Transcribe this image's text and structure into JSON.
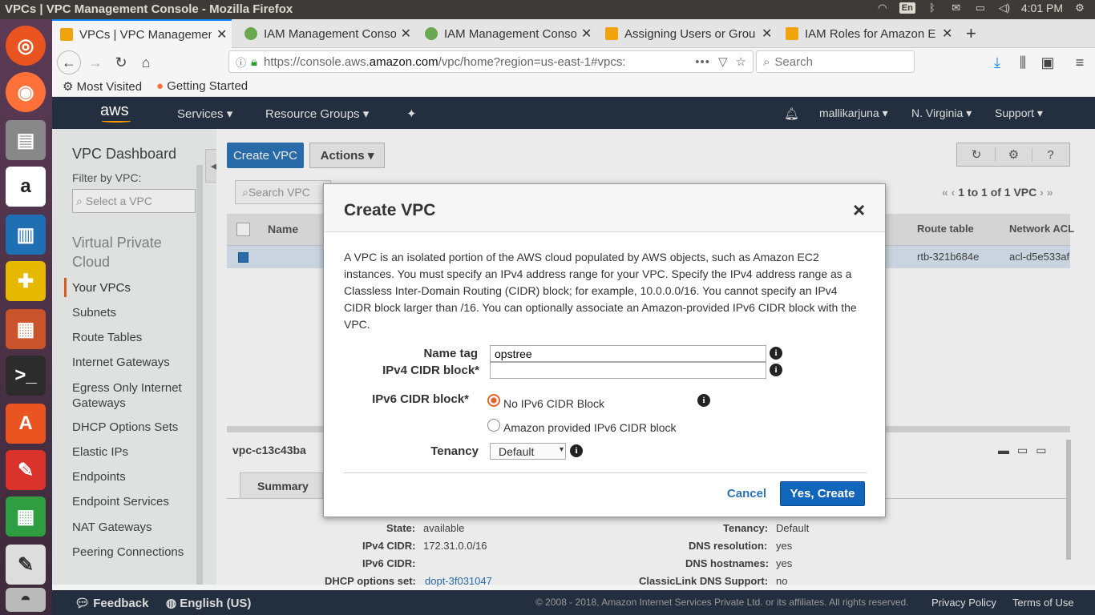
{
  "system": {
    "window_title": "VPCs | VPC Management Console - Mozilla Firefox",
    "keyboard": "En",
    "time": "4:01 PM"
  },
  "tabs": [
    {
      "label": "VPCs | VPC Managemen",
      "color": "#f0a30a"
    },
    {
      "label": "IAM Management Conso",
      "color": "#6aa84f"
    },
    {
      "label": "IAM Management Conso",
      "color": "#6aa84f"
    },
    {
      "label": "Assigning Users or Grou",
      "color": "#f0a30a"
    },
    {
      "label": "IAM Roles for Amazon E",
      "color": "#f0a30a"
    }
  ],
  "nav": {
    "url_prefix": "https://console.aws.",
    "url_domain": "amazon.com",
    "url_suffix": "/vpc/home?region=us-east-1#vpcs:",
    "url_more": "•••",
    "search_placeholder": "Search"
  },
  "bookmarks": {
    "most_visited": "Most Visited",
    "getting_started": "Getting Started"
  },
  "aws": {
    "logo": "aws",
    "services": "Services",
    "resource_groups": "Resource Groups",
    "user": "mallikarjuna",
    "region": "N. Virginia",
    "support": "Support"
  },
  "sidebar": {
    "dashboard": "VPC Dashboard",
    "filter_label": "Filter by VPC:",
    "filter_placeholder": "Select a VPC",
    "section": "Virtual Private Cloud",
    "items": [
      "Your VPCs",
      "Subnets",
      "Route Tables",
      "Internet Gateways",
      "Egress Only Internet Gateways",
      "DHCP Options Sets",
      "Elastic IPs",
      "Endpoints",
      "Endpoint Services",
      "NAT Gateways",
      "Peering Connections"
    ]
  },
  "main": {
    "create_vpc": "Create VPC",
    "actions": "Actions",
    "search_placeholder": "Search VPC",
    "pagination": "1 to 1 of 1 VPC",
    "columns": {
      "name": "Name",
      "route_table": "Route table",
      "network_acl": "Network ACL"
    },
    "row": {
      "route_table": "rtb-321b684e",
      "network_acl": "acl-d5e533af"
    },
    "detail_title": "vpc-c13c43ba",
    "detail_tab": "Summary",
    "details": {
      "state_label": "State:",
      "state": "available",
      "ipv4_label": "IPv4 CIDR:",
      "ipv4": "172.31.0.0/16",
      "ipv6_label": "IPv6 CIDR:",
      "ipv6": "",
      "dhcp_label": "DHCP options set:",
      "dhcp": "dopt-3f031047",
      "tenancy_label": "Tenancy:",
      "tenancy": "Default",
      "dns_res_label": "DNS resolution:",
      "dns_res": "yes",
      "dns_host_label": "DNS hostnames:",
      "dns_host": "yes",
      "classic_label": "ClassicLink DNS Support:",
      "classic": "no"
    }
  },
  "modal": {
    "title": "Create VPC",
    "close": "×",
    "description": "A VPC is an isolated portion of the AWS cloud populated by AWS objects, such as Amazon EC2 instances. You must specify an IPv4 address range for your VPC. Specify the IPv4 address range as a Classless Inter-Domain Routing (CIDR) block; for example, 10.0.0.0/16. You cannot specify an IPv4 CIDR block larger than /16. You can optionally associate an Amazon-provided IPv6 CIDR block with the VPC.",
    "name_tag_label": "Name tag",
    "name_tag_value": "opstree",
    "ipv4_label": "IPv4 CIDR block*",
    "ipv4_value": "",
    "ipv6_label": "IPv6 CIDR block*",
    "ipv6_opt1": "No IPv6 CIDR Block",
    "ipv6_opt2": "Amazon provided IPv6 CIDR block",
    "tenancy_label": "Tenancy",
    "tenancy_value": "Default",
    "cancel": "Cancel",
    "create": "Yes, Create"
  },
  "footer": {
    "feedback": "Feedback",
    "language": "English (US)",
    "copyright": "© 2008 - 2018, Amazon Internet Services Private Ltd. or its affiliates. All rights reserved.",
    "privacy": "Privacy Policy",
    "terms": "Terms of Use"
  }
}
